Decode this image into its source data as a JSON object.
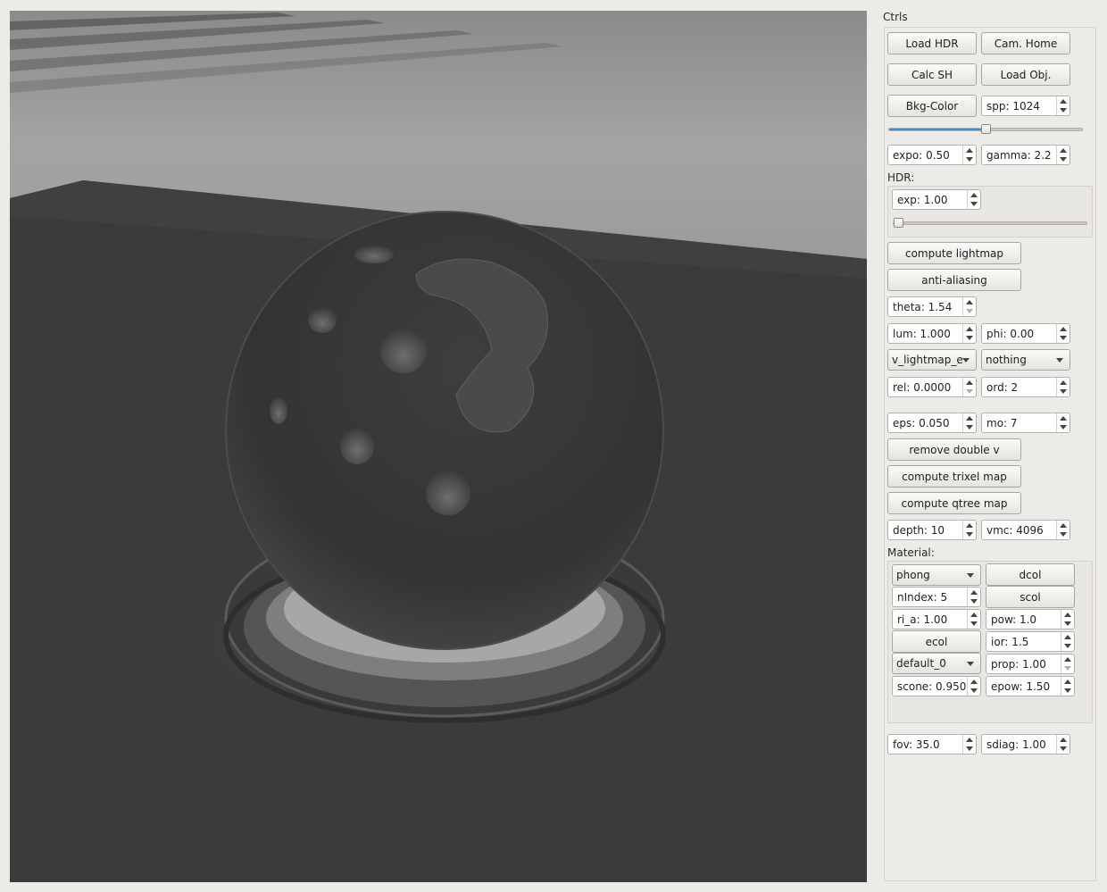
{
  "panel": {
    "title": "Ctrls",
    "buttons": {
      "load_hdr": "Load HDR",
      "cam_home": "Cam. Home",
      "calc_sh": "Calc SH",
      "load_obj": "Load Obj.",
      "bkg_color": "Bkg-Color",
      "compute_lightmap": "compute lightmap",
      "anti_aliasing": "anti-aliasing",
      "remove_double_v": "remove double v",
      "compute_trixel_map": "compute trixel map",
      "compute_qtree_map": "compute qtree map"
    },
    "spp": "spp: 1024",
    "spp_slider_fraction": 0.5,
    "expo": "expo: 0.50",
    "gamma": "gamma: 2.2",
    "hdr": {
      "label": "HDR:",
      "exp": "exp: 1.00",
      "exp_slider_fraction": 0.0
    },
    "theta": "theta: 1.54",
    "lum": "lum: 1.000",
    "phi": "phi: 0.00",
    "combo_lightmap": "v_lightmap_e",
    "combo_nothing": "nothing",
    "rel": "rel: 0.0000",
    "ord": "ord: 2",
    "eps": "eps: 0.050",
    "mo": "mo: 7",
    "depth": "depth: 10",
    "vmc": "vmc: 4096",
    "material": {
      "label": "Material:",
      "shader": "phong",
      "dcol": "dcol",
      "nindex": "nIndex: 5",
      "scol": "scol",
      "ri_a": "ri_a: 1.00",
      "pow": "pow: 1.0",
      "ecol": "ecol",
      "ior": "ior: 1.5",
      "preset": "default_0",
      "prop": "prop: 1.00",
      "scone": "scone: 0.950",
      "epow": "epow: 1.50"
    },
    "fov": "fov: 35.0",
    "sdiag": "sdiag: 1.00"
  },
  "colors": {
    "accent": "#3c8fd6",
    "panel_bg": "#edebe7",
    "viewport_bg": "#3a3a3a"
  }
}
